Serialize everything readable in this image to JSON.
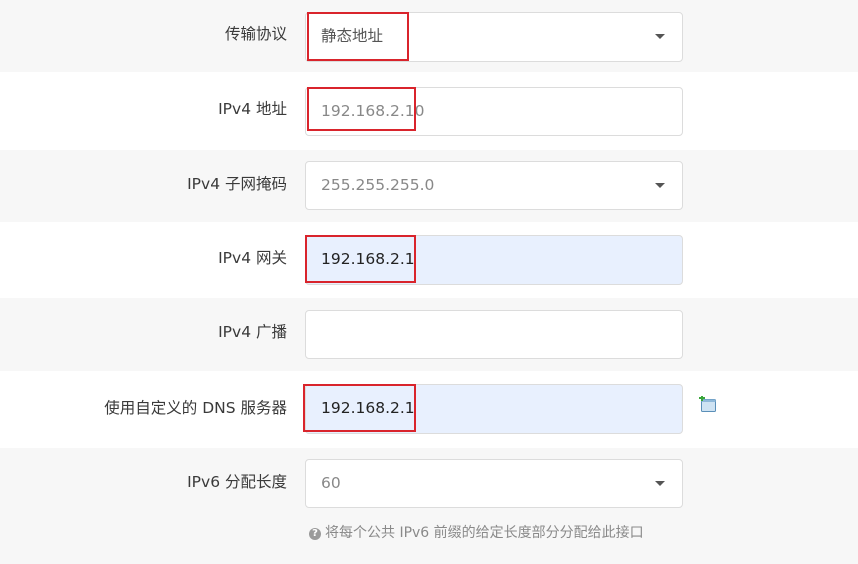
{
  "form": {
    "protocol": {
      "label": "传输协议",
      "value": "静态地址"
    },
    "ipv4_address": {
      "label": "IPv4 地址",
      "value": "192.168.2.10"
    },
    "ipv4_netmask": {
      "label": "IPv4 子网掩码",
      "value": "255.255.255.0"
    },
    "ipv4_gateway": {
      "label": "IPv4 网关",
      "value": "192.168.2.1"
    },
    "ipv4_broadcast": {
      "label": "IPv4 广播",
      "value": ""
    },
    "custom_dns": {
      "label": "使用自定义的 DNS 服务器",
      "value": "192.168.2.1",
      "add_icon": "add-entry-icon"
    },
    "ipv6_prefix_length": {
      "label": "IPv6 分配长度",
      "value": "60"
    }
  },
  "hint": {
    "icon": "question-circle-icon",
    "text": "将每个公共 IPv6 前缀的给定长度部分分配给此接口"
  },
  "colors": {
    "highlight": "#d9242c",
    "autofill": "#e8f0fe",
    "row_alt": "#f7f7f7"
  }
}
